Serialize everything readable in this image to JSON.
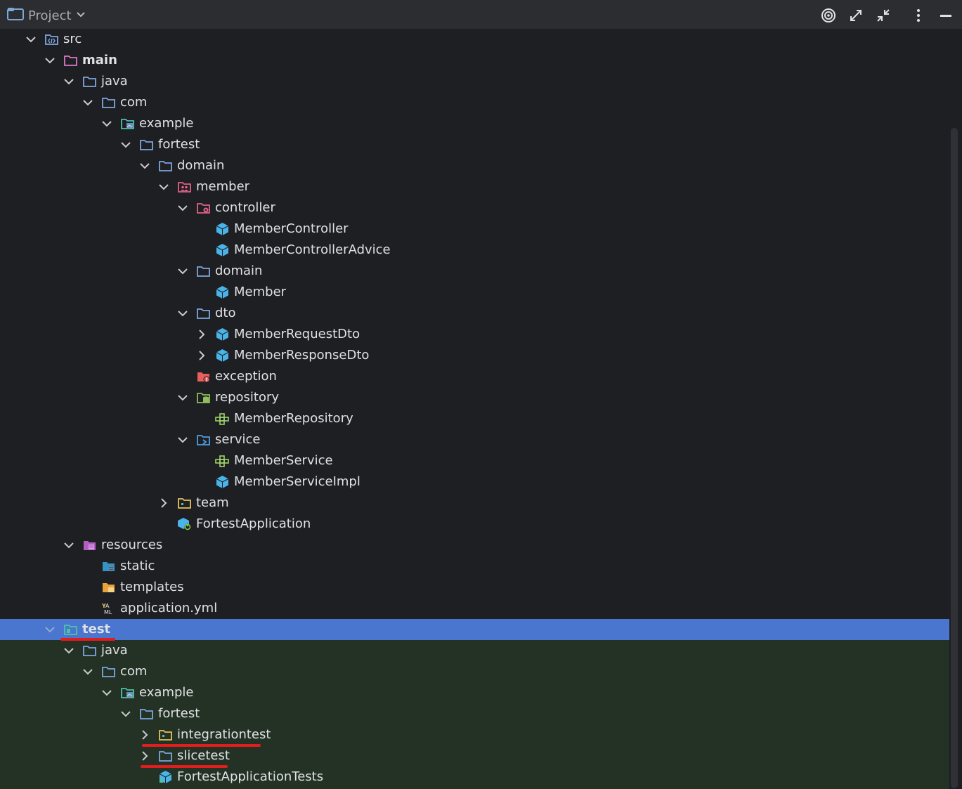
{
  "header": {
    "title": "Project",
    "icons": [
      "target-icon",
      "expand-icon",
      "collapse-icon",
      "more-vert-icon",
      "minimize-icon"
    ]
  },
  "tree": [
    {
      "label": "src",
      "depth": 0,
      "chevron": "down",
      "icon": "source-folder-icon",
      "bold": false
    },
    {
      "label": "main",
      "depth": 1,
      "chevron": "down",
      "icon": "module-folder-icon",
      "bold": true
    },
    {
      "label": "java",
      "depth": 2,
      "chevron": "down",
      "icon": "folder-icon",
      "bold": false
    },
    {
      "label": "com",
      "depth": 3,
      "chevron": "down",
      "icon": "folder-icon",
      "bold": false
    },
    {
      "label": "example",
      "depth": 4,
      "chevron": "down",
      "icon": "image-folder-icon",
      "bold": false
    },
    {
      "label": "fortest",
      "depth": 5,
      "chevron": "down",
      "icon": "folder-icon",
      "bold": false
    },
    {
      "label": "domain",
      "depth": 6,
      "chevron": "down",
      "icon": "folder-icon",
      "bold": false
    },
    {
      "label": "member",
      "depth": 7,
      "chevron": "down",
      "icon": "people-folder-icon",
      "bold": false
    },
    {
      "label": "controller",
      "depth": 8,
      "chevron": "down",
      "icon": "gear-folder-icon",
      "bold": false
    },
    {
      "label": "MemberController",
      "depth": 9,
      "chevron": "none",
      "icon": "class-cube-icon",
      "bold": false
    },
    {
      "label": "MemberControllerAdvice",
      "depth": 9,
      "chevron": "none",
      "icon": "class-cube-icon",
      "bold": false
    },
    {
      "label": "domain",
      "depth": 8,
      "chevron": "down",
      "icon": "folder-icon",
      "bold": false
    },
    {
      "label": "Member",
      "depth": 9,
      "chevron": "none",
      "icon": "class-cube-icon",
      "bold": false
    },
    {
      "label": "dto",
      "depth": 8,
      "chevron": "down",
      "icon": "folder-icon",
      "bold": false
    },
    {
      "label": "MemberRequestDto",
      "depth": 9,
      "chevron": "right",
      "icon": "class-cube-icon",
      "bold": false
    },
    {
      "label": "MemberResponseDto",
      "depth": 9,
      "chevron": "right",
      "icon": "class-cube-icon",
      "bold": false
    },
    {
      "label": "exception",
      "depth": 8,
      "chevron": "none",
      "icon": "exception-folder-icon",
      "bold": false
    },
    {
      "label": "repository",
      "depth": 8,
      "chevron": "down",
      "icon": "database-folder-icon",
      "bold": false
    },
    {
      "label": "MemberRepository",
      "depth": 9,
      "chevron": "none",
      "icon": "interface-icon",
      "bold": false
    },
    {
      "label": "service",
      "depth": 8,
      "chevron": "down",
      "icon": "service-folder-icon",
      "bold": false
    },
    {
      "label": "MemberService",
      "depth": 9,
      "chevron": "none",
      "icon": "interface-icon",
      "bold": false
    },
    {
      "label": "MemberServiceImpl",
      "depth": 9,
      "chevron": "none",
      "icon": "class-cube-icon",
      "bold": false
    },
    {
      "label": "team",
      "depth": 7,
      "chevron": "right",
      "icon": "yellow-folder-icon",
      "bold": false
    },
    {
      "label": "FortestApplication",
      "depth": 7,
      "chevron": "none",
      "icon": "spring-app-icon",
      "bold": false
    },
    {
      "label": "resources",
      "depth": 2,
      "chevron": "down",
      "icon": "resources-folder-icon",
      "bold": false
    },
    {
      "label": "static",
      "depth": 3,
      "chevron": "none",
      "icon": "web-folder-icon",
      "bold": false
    },
    {
      "label": "templates",
      "depth": 3,
      "chevron": "none",
      "icon": "templates-folder-icon",
      "bold": false
    },
    {
      "label": "application.yml",
      "depth": 3,
      "chevron": "none",
      "icon": "yaml-file-icon",
      "bold": false
    },
    {
      "label": "test",
      "depth": 1,
      "chevron": "down",
      "icon": "test-folder-icon",
      "bold": true,
      "selected": true
    },
    {
      "label": "java",
      "depth": 2,
      "chevron": "down",
      "icon": "folder-icon",
      "bold": false
    },
    {
      "label": "com",
      "depth": 3,
      "chevron": "down",
      "icon": "folder-icon",
      "bold": false
    },
    {
      "label": "example",
      "depth": 4,
      "chevron": "down",
      "icon": "image-folder-icon",
      "bold": false
    },
    {
      "label": "fortest",
      "depth": 5,
      "chevron": "down",
      "icon": "folder-icon",
      "bold": false
    },
    {
      "label": "integrationtest",
      "depth": 6,
      "chevron": "right",
      "icon": "yellow-folder-icon",
      "bold": false
    },
    {
      "label": "slicetest",
      "depth": 6,
      "chevron": "right",
      "icon": "folder-icon",
      "bold": false
    },
    {
      "label": "FortestApplicationTests",
      "depth": 6,
      "chevron": "none",
      "icon": "spring-test-icon",
      "bold": false
    }
  ],
  "colors": {
    "background": "#1e1f22",
    "header": "#2b2d30",
    "selection": "#4a76cf",
    "test_background": "#263322",
    "annotation": "#e11d1d"
  }
}
